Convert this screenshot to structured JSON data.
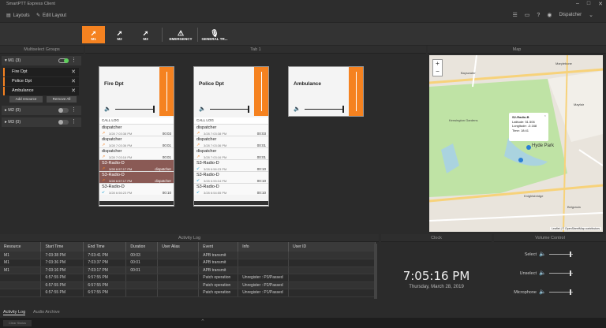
{
  "app": {
    "title": "SmartPTT Express Client"
  },
  "menu": {
    "layouts": "Layouts",
    "edit_layout": "Edit Layout",
    "user": "Dispatcher"
  },
  "toolbar": [
    {
      "label": "M1",
      "icon": "arrow-icon",
      "active": true
    },
    {
      "label": "M2",
      "icon": "arrow-icon",
      "active": false
    },
    {
      "label": "M3",
      "icon": "arrow-icon",
      "active": false
    },
    {
      "label": "EMERGENCY",
      "icon": "warning-icon",
      "active": false
    },
    {
      "label": "GENERAL TR...",
      "icon": "microphone-icon",
      "active": false
    }
  ],
  "multiselect": {
    "header": "Multiselect Groups",
    "groups": [
      {
        "name": "M1 (3)",
        "on": true
      },
      {
        "name": "M2 (0)",
        "on": false
      },
      {
        "name": "M3 (0)",
        "on": false
      }
    ],
    "resources": [
      "Fire Dpt",
      "Police Dpt",
      "Ambulance"
    ],
    "add_resource": "Add resource",
    "remove_all": "Remove All"
  },
  "tab": {
    "header": "Tab 1"
  },
  "cards": [
    {
      "name": "Fire Dpt",
      "call_log_label": "CALL LOG",
      "entries": [
        {
          "who": "dispatcher",
          "time": "3/28 7:03:38 PM",
          "dur": "00:03",
          "dir": "out",
          "hl": false
        },
        {
          "who": "dispatcher",
          "time": "3/28 7:03:36 PM",
          "dur": "00:01",
          "dir": "out",
          "hl": false
        },
        {
          "who": "dispatcher",
          "time": "3/28 7:03:16 PM",
          "dur": "00:01",
          "dir": "out",
          "hl": false
        },
        {
          "who": "S3-Radio-D",
          "time": "3/28 6:57:17 PM",
          "dur": "dispatcher",
          "dir": "patch",
          "hl": true
        },
        {
          "who": "S3-Radio-D",
          "time": "3/28 6:57:17 PM",
          "dur": "dispatcher",
          "dir": "patch",
          "hl": true
        },
        {
          "who": "S3-Radio-D",
          "time": "3/28 6:56:23 PM",
          "dur": "00:10",
          "dir": "in",
          "hl": false
        }
      ]
    },
    {
      "name": "Police Dpt",
      "call_log_label": "CALL LOG",
      "entries": [
        {
          "who": "dispatcher",
          "time": "3/28 7:03:38 PM",
          "dur": "00:03",
          "dir": "out",
          "hl": false
        },
        {
          "who": "dispatcher",
          "time": "3/28 7:03:36 PM",
          "dur": "00:01",
          "dir": "out",
          "hl": false
        },
        {
          "who": "dispatcher",
          "time": "3/28 7:03:16 PM",
          "dur": "00:01",
          "dir": "out",
          "hl": false
        },
        {
          "who": "S3-Radio-D",
          "time": "3/28 6:56:23 PM",
          "dur": "00:10",
          "dir": "in",
          "hl": false
        },
        {
          "who": "S3-Radio-D",
          "time": "3/28 6:55:04 PM",
          "dur": "00:10",
          "dir": "in",
          "hl": false
        },
        {
          "who": "S3-Radio-D",
          "time": "3/28 6:54:55 PM",
          "dur": "00:10",
          "dir": "in",
          "hl": false
        }
      ]
    },
    {
      "name": "Ambulance",
      "call_log_label": "",
      "entries": []
    }
  ],
  "map": {
    "header": "Map",
    "popup": {
      "title": "S2-Radio-B",
      "lat": "Latitude: 51.506",
      "lon": "Longitude: -0.168",
      "time": "Time: 18:41"
    },
    "labels": [
      "Hyde Park",
      "Kensington Gardens",
      "Mayfair",
      "Marylebone",
      "Bayswater",
      "Knightsbridge",
      "Belgravia"
    ],
    "attribution": "Leaflet | © OpenStreetMap contributors"
  },
  "activity_log": {
    "header": "Activity Log",
    "columns": [
      "Resource",
      "Start Time",
      "End Time",
      "Duration",
      "User Alias",
      "Event",
      "Info",
      "User ID"
    ],
    "rows": [
      [
        "M1",
        "7:03:38 PM",
        "7:03:41 PM",
        "00:03",
        "",
        "APB transmit",
        "",
        ""
      ],
      [
        "M1",
        "7:03:36 PM",
        "7:03:37 PM",
        "00:01",
        "",
        "APB transmit",
        "",
        ""
      ],
      [
        "M1",
        "7:03:16 PM",
        "7:03:17 PM",
        "00:01",
        "",
        "APB transmit",
        "",
        ""
      ],
      [
        "",
        "6:57:55 PM",
        "6:57:55 PM",
        "",
        "",
        "Patch operation",
        "Unregister : P3/Passed",
        ""
      ],
      [
        "",
        "6:57:55 PM",
        "6:57:55 PM",
        "",
        "",
        "Patch operation",
        "Unregister : P2/Passed",
        ""
      ],
      [
        "",
        "6:57:55 PM",
        "6:57:55 PM",
        "",
        "",
        "Patch operation",
        "Unregister : P1/Passed",
        ""
      ]
    ]
  },
  "bottom_tabs": [
    "Activity Log",
    "Audio Archive"
  ],
  "clock": {
    "header": "Clock",
    "time": "7:05:16 PM",
    "date": "Thursday, March 28, 2019"
  },
  "volume": {
    "header": "Volume Control",
    "rows": [
      "Select",
      "Unselect",
      "Microphone"
    ]
  },
  "status": {
    "label": "Clear Status"
  }
}
